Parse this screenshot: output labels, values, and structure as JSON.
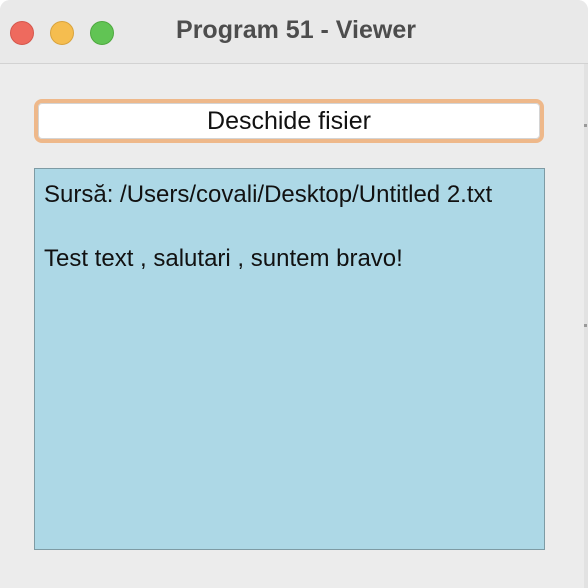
{
  "window": {
    "title": "Program 51 - Viewer",
    "controls": {
      "close_color": "#ee6a5e",
      "minimize_color": "#f5bd4f",
      "zoom_color": "#61c454"
    }
  },
  "toolbar": {
    "open_button_label": "Deschide fisier",
    "open_button_border_color": "#eeb88a"
  },
  "content": {
    "background_color": "#add8e6",
    "source_line": "Sursă: /Users/covali/Desktop/Untitled 2.txt",
    "file_text": "Test text , salutari , suntem bravo!"
  }
}
